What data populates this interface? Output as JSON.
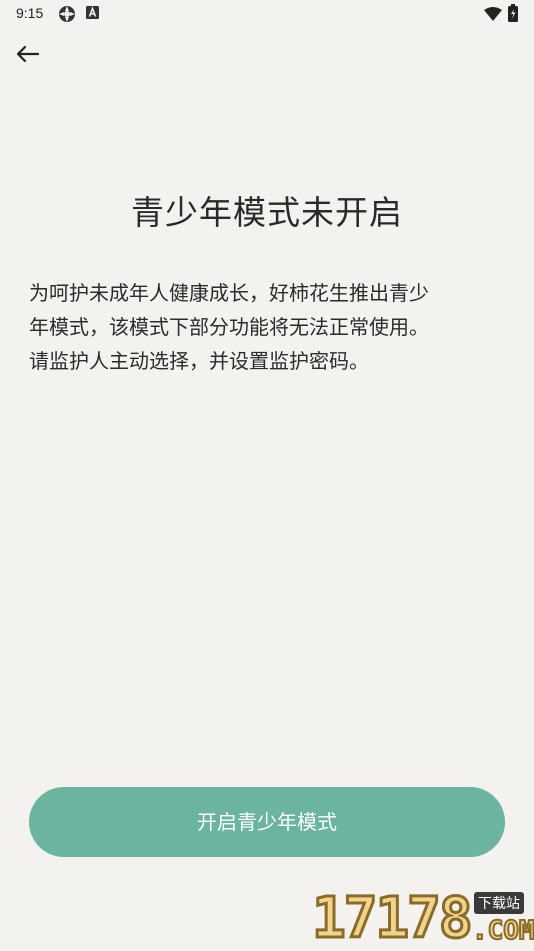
{
  "status_bar": {
    "time": "9:15",
    "icons": [
      "settings-gear-icon",
      "a-badge-icon",
      "wifi-icon",
      "battery-icon"
    ]
  },
  "toolbar": {
    "back_icon": "back-arrow-icon"
  },
  "main": {
    "title": "青少年模式未开启",
    "description_lines": [
      "为呵护未成年人健康成长，好柿花生推出青少",
      "年模式，该模式下部分功能将无法正常使用。",
      "请监护人主动选择，并设置监护密码。"
    ]
  },
  "actions": {
    "enable_label": "开启青少年模式"
  },
  "watermark": {
    "digits": "17178",
    "badge": "下载站",
    "suffix": ".COM"
  },
  "colors": {
    "background": "#f3f2ee",
    "primary": "#6bb5a0",
    "text": "#2b2b2b"
  }
}
